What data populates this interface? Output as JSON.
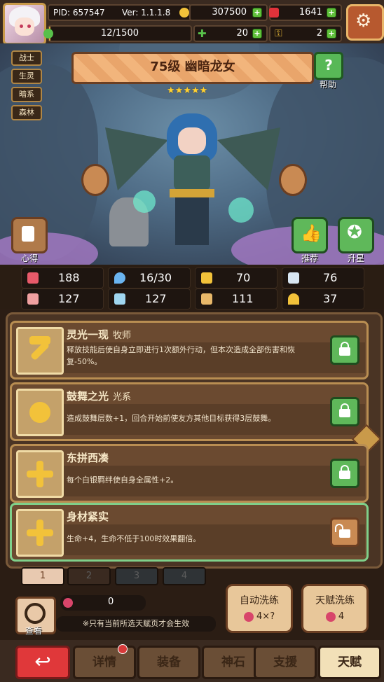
{
  "topbar": {
    "pid": "PID: 657547",
    "version": "Ver: 1.1.1.8",
    "gold": "307500",
    "gems": "1641",
    "xp": "12/1500",
    "xp_fraction": 0.008,
    "clover": "20",
    "key": "2"
  },
  "hero": {
    "tags": [
      "战士",
      "生灵",
      "暗系",
      "森林"
    ],
    "name": "75级 幽暗龙女",
    "stars": 5,
    "help_label": "帮助",
    "help_glyph": "?",
    "left_button_label": "心得",
    "recommend_label": "推荐",
    "upgrade_label": "升星"
  },
  "stats": [
    {
      "icon": "heart-icon",
      "color": "#e85a6a",
      "value": "188"
    },
    {
      "icon": "water-drop-icon",
      "color": "#6ab4f0",
      "value": "16/30"
    },
    {
      "icon": "shield-icon",
      "color": "#f2c23a",
      "value": "70"
    },
    {
      "icon": "wing-icon",
      "color": "#d8e6f2",
      "value": "76"
    },
    {
      "icon": "fist-icon",
      "color": "#f0a0a0",
      "value": "127"
    },
    {
      "icon": "book-icon",
      "color": "#9fd6f0",
      "value": "127"
    },
    {
      "icon": "scroll-icon",
      "color": "#e8b86a",
      "value": "111"
    },
    {
      "icon": "horseshoe-icon",
      "color": "#f2c23a",
      "value": "37"
    }
  ],
  "talents": [
    {
      "name": "灵光一现",
      "type": "牧师",
      "desc": "释放技能后使自身立即进行1次额外行动，但本次造成全部伤害和恢复-50%。",
      "icon": "hammer-icon",
      "locked": true
    },
    {
      "name": "鼓舞之光",
      "type": "光系",
      "desc": "造成鼓舞层数+1，回合开始前使友方其他目标获得3层鼓舞。",
      "icon": "sun-icon",
      "locked": true
    },
    {
      "name": "东拼西凑",
      "type": "",
      "desc": "每个白银羁绊使自身全属性+2。",
      "icon": "cross-icon",
      "locked": true
    },
    {
      "name": "身材紧实",
      "type": "",
      "desc": "生命+4，生命不低于100时效果翻倍。",
      "icon": "cross-icon",
      "locked": false
    }
  ],
  "pages": [
    "1",
    "2",
    "3",
    "4"
  ],
  "bottom": {
    "view_label": "查看",
    "potion_count": "0",
    "note": "※只有当前所选天赋页才会生效",
    "auto_refine_label": "自动洗练",
    "auto_refine_cost": "4×?",
    "talent_refine_label": "天赋洗练",
    "talent_refine_cost": "4"
  },
  "nav": {
    "back_glyph": "↩",
    "items": [
      "详情",
      "装备",
      "神石",
      "支援",
      "天赋"
    ]
  }
}
